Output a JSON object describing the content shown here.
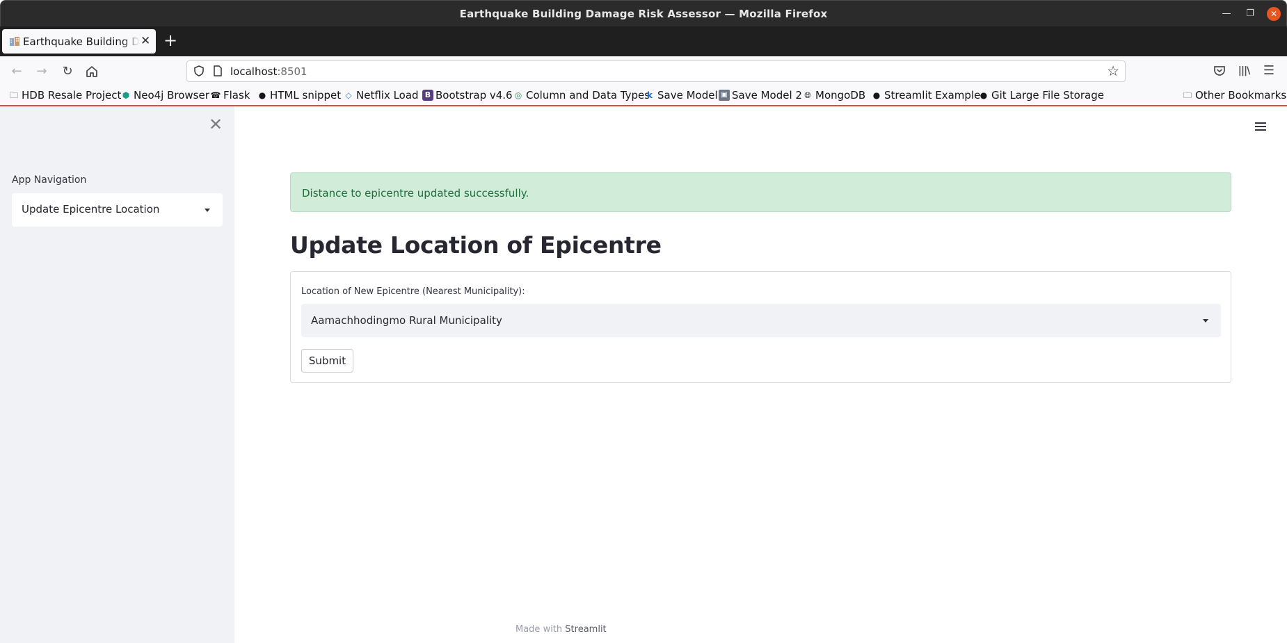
{
  "window": {
    "title": "Earthquake Building Damage Risk Assessor — Mozilla Firefox"
  },
  "tab": {
    "title": "Earthquake Building Damage Risk Assessor",
    "close": "✕",
    "new_tab": "+"
  },
  "address_bar": {
    "host": "localhost",
    "port": ":8501"
  },
  "bookmarks": {
    "items": [
      {
        "label": "HDB Resale Project",
        "icon": "folder-icon"
      },
      {
        "label": "Neo4j Browser",
        "icon": "neo4j-icon"
      },
      {
        "label": "Flask",
        "icon": "flask-icon"
      },
      {
        "label": "HTML snippet",
        "icon": "github-icon"
      },
      {
        "label": "Netflix Load",
        "icon": "code-icon"
      },
      {
        "label": "Bootstrap v4.6",
        "icon": "bootstrap-icon"
      },
      {
        "label": "Column and Data Types",
        "icon": "target-icon"
      },
      {
        "label": "Save Model",
        "icon": "k-icon"
      },
      {
        "label": "Save Model 2",
        "icon": "image-icon"
      },
      {
        "label": "MongoDB",
        "icon": "globe-icon"
      },
      {
        "label": "Streamlit Example",
        "icon": "github-icon"
      },
      {
        "label": "Git Large File Storage",
        "icon": "github-icon"
      }
    ],
    "other": "Other Bookmarks"
  },
  "sidebar": {
    "nav_label": "App Navigation",
    "selected_page": "Update Epicentre Location"
  },
  "main": {
    "alert_message": "Distance to epicentre updated successfully.",
    "alert_color": "#d1ecd9",
    "title": "Update Location of Epicentre",
    "form": {
      "field_label": "Location of New Epicentre (Nearest Municipality):",
      "selected_value": "Aamachhodingmo Rural Municipality",
      "submit_label": "Submit"
    }
  },
  "footer": {
    "prefix": "Made with",
    "brand": "Streamlit"
  },
  "colors": {
    "accent_close": "#e95420",
    "sidebar_bg": "#f0f2f6",
    "success_text": "#1f6e3c"
  }
}
